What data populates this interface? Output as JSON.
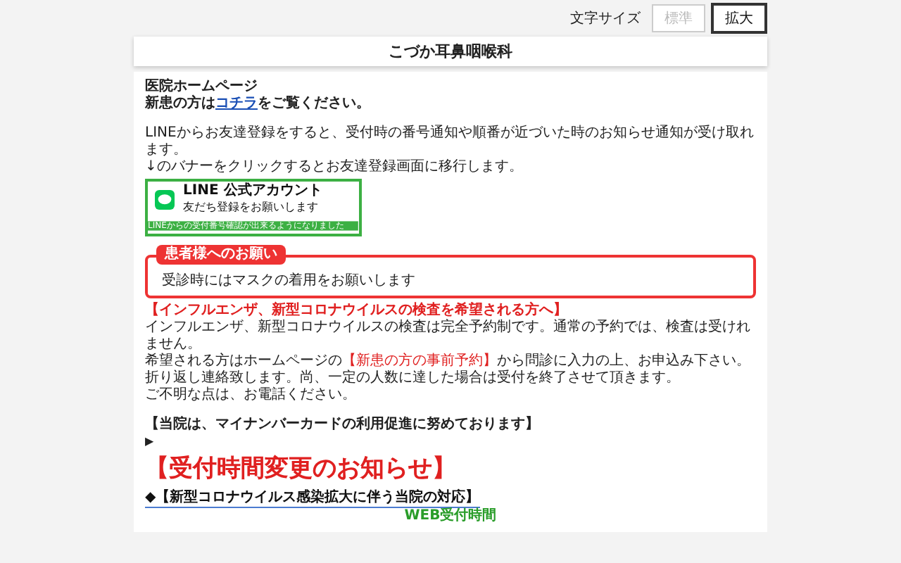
{
  "font_size": {
    "label": "文字サイズ",
    "options": [
      {
        "label": "標準",
        "selected": false
      },
      {
        "label": "拡大",
        "selected": true
      }
    ]
  },
  "site_title": "こづか耳鼻咽喉科",
  "intro": {
    "heading": "医院ホームページ",
    "new_patient": {
      "before": "新患の方は",
      "link": "コチラ",
      "after": "をご覧ください。"
    }
  },
  "line_text": [
    "LINEからお友達登録をすると、受付時の番号通知や順番が近づいた時のお知らせ通知が受け取れます。",
    "↓のバナーをクリックするとお友達登録画面に移行します。"
  ],
  "line_banner": {
    "title": "LINE 公式アカウント",
    "subtitle": "友だち登録をお願いします",
    "strip": "LINEからの受付番号確認が出来るようになりました"
  },
  "notice": {
    "title": "患者様へのお願い",
    "body": "受診時にはマスクの着用をお願いします"
  },
  "flu": {
    "heading": "【インフルエンザ、新型コロナウイルスの検査を希望される方へ】",
    "lines": [
      {
        "text": "インフルエンザ、新型コロナウイルスの検査は完全予約制です。通常の予約では、検査は受けれません。"
      },
      {
        "text": "希望される方はホームページの**【新患の方の事前予約】**から問診に入力の上、お申込み下さい。"
      },
      {
        "text": "折り返し連絡致します。尚、一定の人数に達した場合は受付を終了させて頂きます。"
      },
      {
        "text": "ご不明な点は、お電話ください。"
      }
    ]
  },
  "my_number": "【当院は、マイナンバーカードの利用促進に努めております】",
  "arrow": "▶",
  "change_notice": "【受付時間変更のお知らせ】",
  "covid_link": "◆【新型コロナウイルス感染拡大に伴う当院の対応】",
  "web_hours": "WEB受付時間"
}
